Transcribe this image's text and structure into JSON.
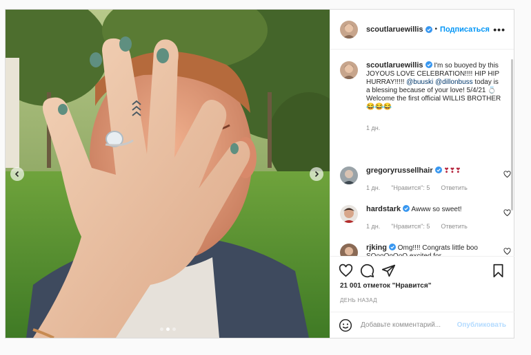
{
  "post": {
    "author": "scoutlaruewillis",
    "follow_label": "Подписаться",
    "separator": "•",
    "more_label": "•••",
    "caption": {
      "user": "scoutlaruewillis",
      "text_1": "I'm so buoyed by this JOYOUS LOVE CELEBRATION!!!! HIP HIP HURRAY!!!!! ",
      "mention_1": "@buuski",
      "text_2": " ",
      "mention_2": "@dillonbuss",
      "text_3": " today is a blessing because of your love! 5/4/21 💍 Welcome the first official WILLIS BROTHER 😂😂😂",
      "time": "1 дн."
    },
    "comments": [
      {
        "user": "gregoryrussellhair",
        "text": "❣❣❣",
        "time": "1 дн.",
        "likes": "\"Нравится\": 5",
        "reply": "Ответить",
        "avatar_color": "#9aa3a8"
      },
      {
        "user": "hardstark",
        "text": "Awww so sweet!",
        "time": "1 дн.",
        "likes": "\"Нравится\": 5",
        "reply": "Ответить",
        "avatar_color": "#5a4a3e"
      },
      {
        "user": "rjking",
        "text": "Omg!!!! Congrats little boo SOooOoOoO excited for",
        "avatar_color": "#8a6a55"
      }
    ],
    "likes_count": "21 001 отметок \"Нравится\"",
    "date": "ДЕНЬ НАЗАД",
    "comment_placeholder": "Добавьте комментарий...",
    "publish_label": "Опубликовать",
    "carousel": {
      "total": 3,
      "current": 1
    }
  },
  "colors": {
    "accent": "#0095f6",
    "verified": "#3897f0",
    "nail_polish": "#5f8f80"
  },
  "icons": [
    "heart-icon",
    "comment-icon",
    "share-icon",
    "bookmark-icon",
    "emoji-icon",
    "chevron-left-icon",
    "chevron-right-icon",
    "verified-icon"
  ]
}
